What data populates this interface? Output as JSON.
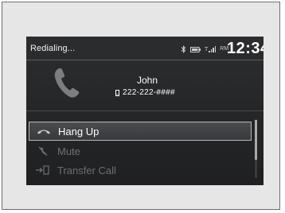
{
  "status": {
    "text": "Redialing...",
    "clock": "12:34",
    "signal_label": "T",
    "roaming_label": "RM",
    "icons": [
      "bluetooth-icon",
      "battery-icon",
      "signal-icon"
    ]
  },
  "call": {
    "caller_name": "John",
    "caller_number": "222-222-####",
    "icons": [
      "phone-handset-icon",
      "mobile-phone-icon"
    ]
  },
  "menu": {
    "items": [
      {
        "label": "Hang Up",
        "icon": "hang-up-icon",
        "state": "selected"
      },
      {
        "label": "Mute",
        "icon": "mute-icon",
        "state": "disabled"
      },
      {
        "label": "Transfer Call",
        "icon": "transfer-call-icon",
        "state": "disabled"
      }
    ]
  },
  "colors": {
    "screen_background": "#262729",
    "text_active": "#ffffff",
    "text_disabled": "#6e6f71",
    "selection_border": "#b8b8b8"
  }
}
